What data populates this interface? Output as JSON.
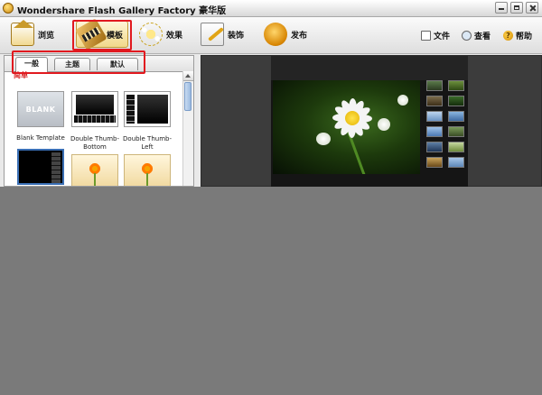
{
  "window": {
    "title": "Wondershare Flash Gallery Factory 豪华版"
  },
  "toolbar": {
    "buttons": [
      {
        "label": "浏览",
        "icon": "house-icon"
      },
      {
        "label": "模板",
        "icon": "film-icon",
        "active": true
      },
      {
        "label": "效果",
        "icon": "sparkle-icon"
      },
      {
        "label": "装饰",
        "icon": "brush-icon"
      },
      {
        "label": "发布",
        "icon": "publish-icon"
      }
    ],
    "right_buttons": [
      {
        "label": "文件",
        "icon": "file-icon"
      },
      {
        "label": "查看",
        "icon": "view-icon"
      },
      {
        "label": "帮助",
        "icon": "help-icon"
      }
    ],
    "help_glyph": "?"
  },
  "tabs": [
    {
      "label": "一般",
      "active": true
    },
    {
      "label": "主题"
    },
    {
      "label": "默认"
    }
  ],
  "section": {
    "label": "简单"
  },
  "templates": [
    {
      "label": "Blank Template",
      "thumb_text": "BLANK"
    },
    {
      "label": "Double Thumb-Bottom"
    },
    {
      "label": "Double Thumb-Left"
    }
  ],
  "colors": {
    "highlight": "#e1191f",
    "section_label": "#d61a1a",
    "selection_border": "#3a6fb5",
    "workspace": "#3c3c3c",
    "background": "#7a7a7a"
  }
}
